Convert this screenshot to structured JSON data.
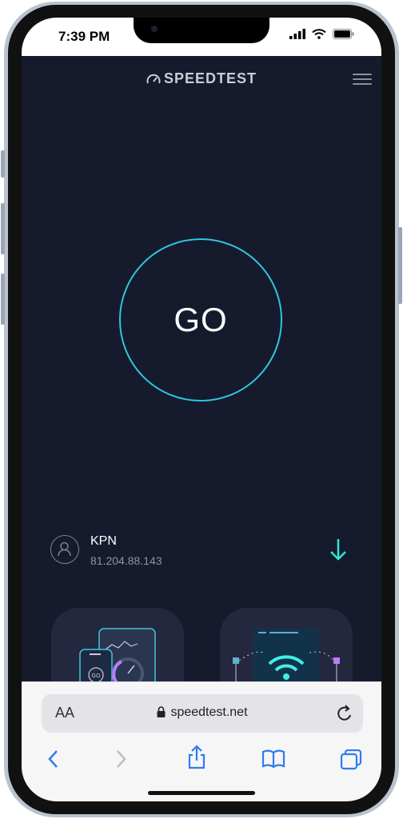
{
  "status_bar": {
    "time": "7:39 PM",
    "icons": [
      "signal-icon",
      "wifi-icon",
      "battery-icon"
    ]
  },
  "header": {
    "logo_text": "SPEEDTEST",
    "logo_icon": "speedometer-icon",
    "menu_icon": "hamburger-menu-icon"
  },
  "main": {
    "go_label": "GO",
    "accent_color": "#2ec7de",
    "background_color": "#161a2d"
  },
  "provider": {
    "name": "KPN",
    "ip": "81.204.88.143",
    "avatar_icon": "user-icon",
    "action_icon": "download-arrow-icon"
  },
  "cards": [
    {
      "icon": "phone-speedtest-illustration",
      "badge": "GO"
    },
    {
      "icon": "wifi-router-illustration"
    }
  ],
  "safari": {
    "text_size_label": "AA",
    "url": "speedtest.net",
    "icons": [
      "lock-icon",
      "reload-icon",
      "back-icon",
      "forward-icon",
      "share-icon",
      "bookmarks-icon",
      "tabs-icon"
    ]
  }
}
